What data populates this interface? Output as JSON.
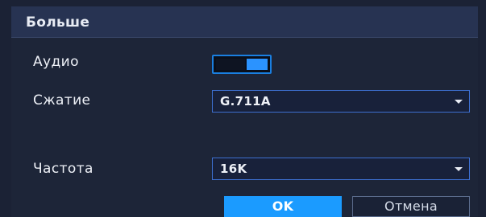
{
  "dialog": {
    "title": "Больше"
  },
  "audio": {
    "label": "Аудио",
    "enabled": true
  },
  "compression": {
    "label": "Сжатие",
    "value": "G.711A"
  },
  "frequency": {
    "label": "Частота",
    "value": "16K"
  },
  "buttons": {
    "ok": "OK",
    "cancel": "Отмена"
  },
  "colors": {
    "accent": "#1b9bff",
    "background": "#1b2235",
    "titlebar": "#273352"
  }
}
